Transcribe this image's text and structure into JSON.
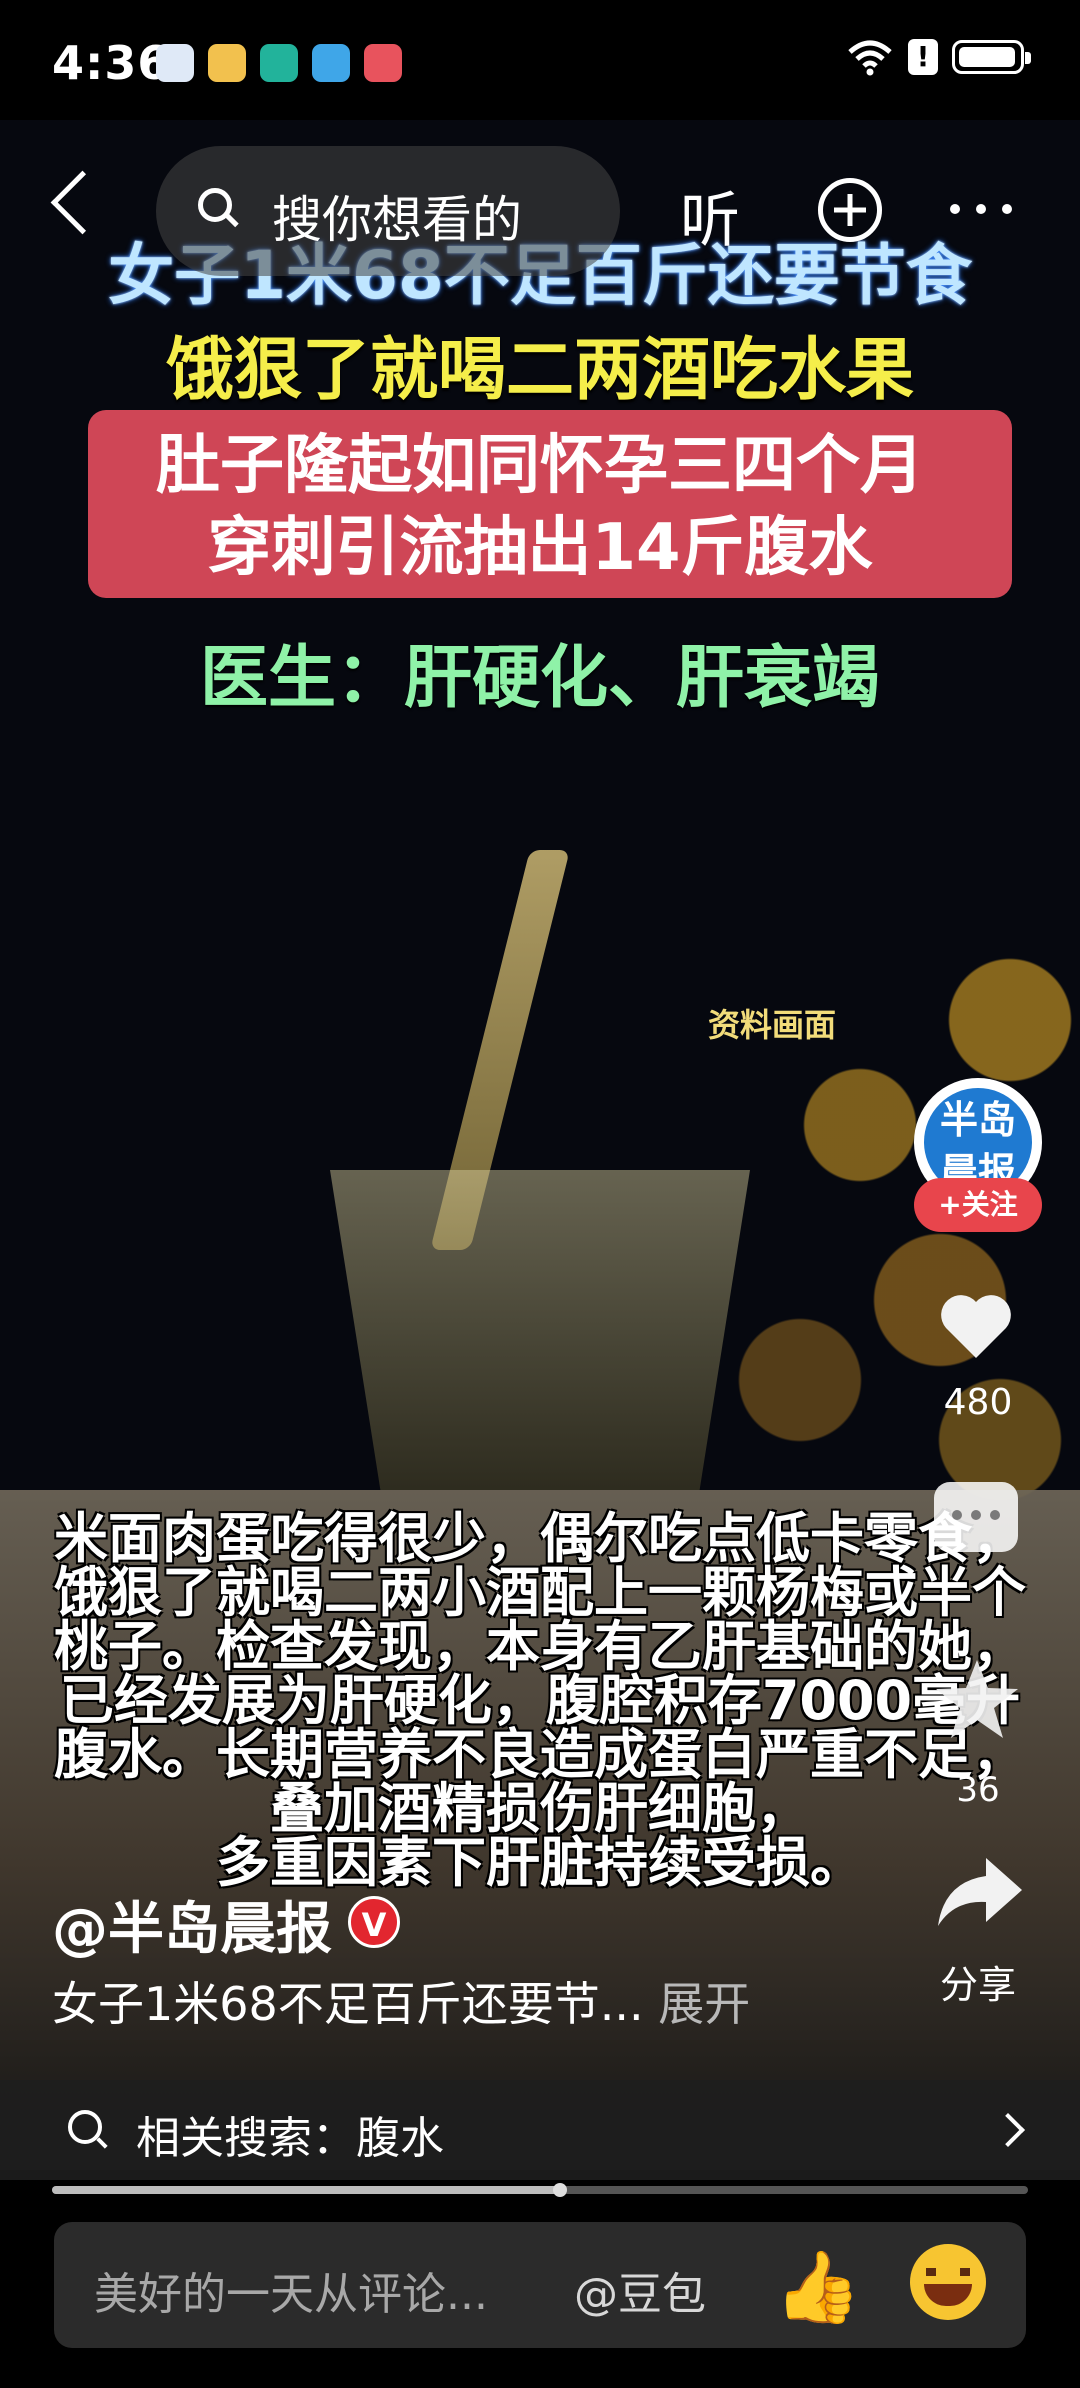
{
  "status_bar": {
    "time": "4:36"
  },
  "top_bar": {
    "search_placeholder": "搜你想看的",
    "listen_label": "听"
  },
  "video": {
    "headline_1": "女子1米68不足百斤还要节食",
    "headline_2": "饿狠了就喝二两酒吃水果",
    "headline_3a": "肚子隆起如同怀孕三四个月",
    "headline_3b": "穿刺引流抽出14斤腹水",
    "headline_4": "医生：肝硬化、肝衰竭",
    "small_caption": "资料画面",
    "overlay_text": "米面肉蛋吃得很少，偶尔吃点低卡零食，\n饿狠了就喝二两小酒配上一颗杨梅或半个\n桃子。检查发现，本身有乙肝基础的她，\n已经发展为肝硬化，腹腔积存7000毫升\n腹水。长期营养不良造成蛋白严重不足，\n叠加酒精损伤肝细胞，\n多重因素下肝脏持续受损。"
  },
  "actions": {
    "avatar_text": "半岛晨报",
    "follow_label": "+关注",
    "like_count": "480",
    "favorite_count": "36",
    "share_label": "分享"
  },
  "post": {
    "author": "@半岛晨报",
    "verified_badge": "V",
    "description": "女子1米68不足百斤还要节...",
    "expand_label": "展开"
  },
  "related_search": {
    "label": "相关搜索：腹水"
  },
  "playback": {
    "progress": 0.52
  },
  "comment_bar": {
    "placeholder": "美好的一天从评论...",
    "mention": "@豆包",
    "thumb_emoji": "👍"
  },
  "colors": {
    "follow_red": "#e8454c",
    "verified_red": "#e2262f",
    "headline_blue": "#bfe6ff",
    "headline_yellow": "#f5ee4a",
    "headline_green": "#8ff2a8",
    "red_box": "#cf4656"
  },
  "icons": [
    "back-icon",
    "search-icon",
    "add-icon",
    "more-icon",
    "heart-icon",
    "comment-icon",
    "star-icon",
    "share-icon",
    "chevron-right-icon"
  ]
}
